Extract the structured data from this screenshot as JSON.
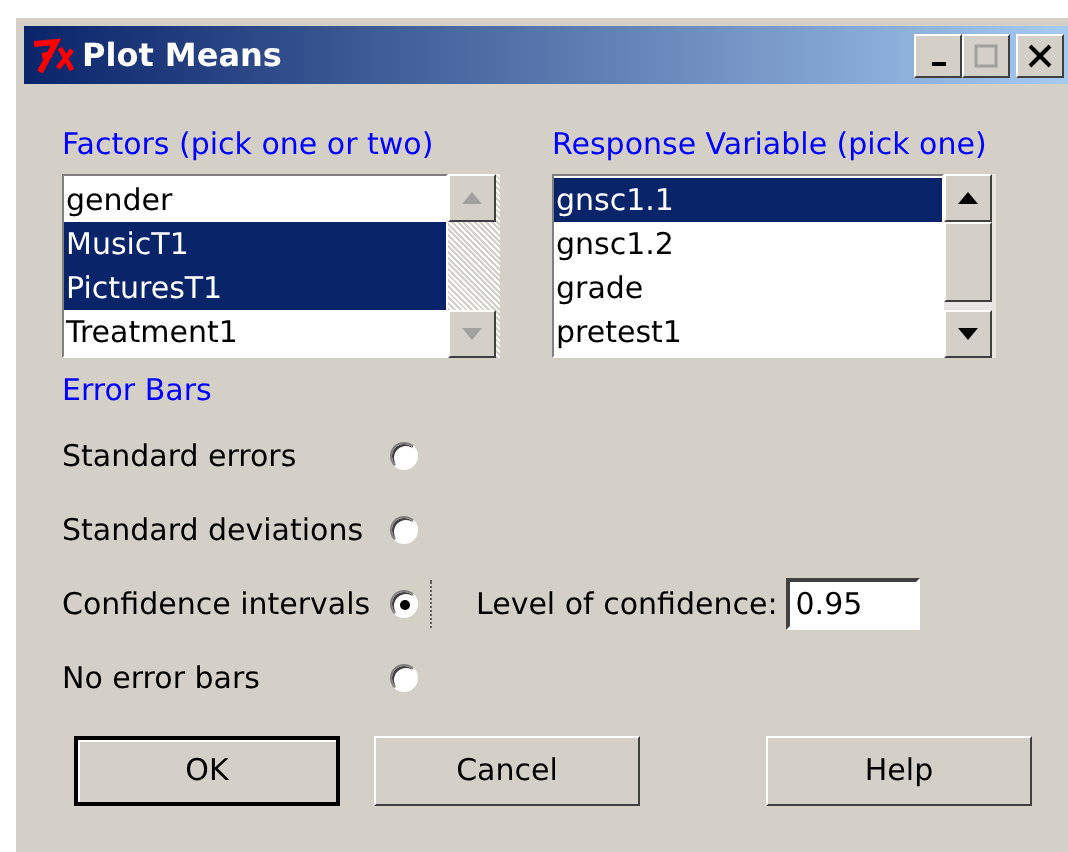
{
  "window": {
    "title": "Plot Means"
  },
  "factors": {
    "label": "Factors (pick one or two)",
    "scroll_enabled": false,
    "items": [
      {
        "text": "gender",
        "selected": false
      },
      {
        "text": "MusicT1",
        "selected": true
      },
      {
        "text": "PicturesT1",
        "selected": true
      },
      {
        "text": "Treatment1",
        "selected": false
      }
    ]
  },
  "response": {
    "label": "Response Variable (pick one)",
    "scroll_enabled": true,
    "items": [
      {
        "text": "gnsc1.1",
        "selected": true
      },
      {
        "text": "gnsc1.2",
        "selected": false
      },
      {
        "text": "grade",
        "selected": false
      },
      {
        "text": "pretest1",
        "selected": false
      }
    ]
  },
  "error_bars": {
    "label": "Error Bars",
    "options": [
      {
        "text": "Standard errors",
        "selected": false
      },
      {
        "text": "Standard deviations",
        "selected": false
      },
      {
        "text": "Confidence intervals",
        "selected": true
      },
      {
        "text": "No error bars",
        "selected": false
      }
    ],
    "confidence": {
      "label": "Level of confidence:",
      "value": "0.95"
    }
  },
  "buttons": [
    {
      "text": "OK",
      "default": true
    },
    {
      "text": "Cancel",
      "default": false
    },
    {
      "text": "Help",
      "default": false
    }
  ]
}
